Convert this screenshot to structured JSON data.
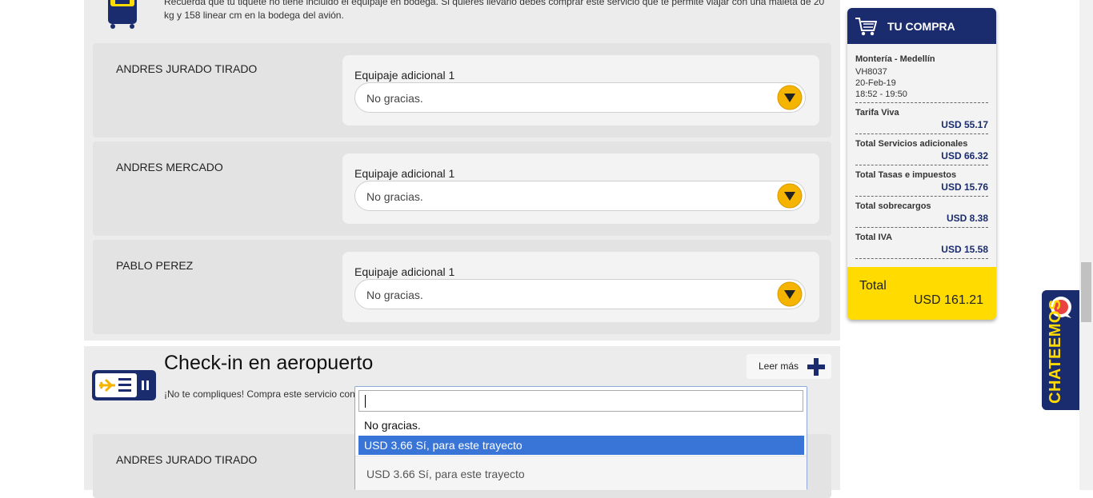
{
  "baggage": {
    "note": "Recuerda que tu tiquete no tiene incluido el equipaje en bodega. Si quieres llevarlo debes comprar este servicio que te permite viajar con una maleta de 20 kg y 158 linear cm en la bodega del avión.",
    "passengers": [
      {
        "name": "ANDRES JURADO TIRADO",
        "label": "Equipaje adicional 1",
        "value": "No gracias."
      },
      {
        "name": "ANDRES MERCADO",
        "label": "Equipaje adicional 1",
        "value": "No gracias."
      },
      {
        "name": "PABLO PEREZ",
        "label": "Equipaje adicional 1",
        "value": "No gracias."
      }
    ]
  },
  "checkin": {
    "title": "Check-in en aeropuerto",
    "description": "¡No te compliques! Compra este servicio con anticipación y haz tu check-in directamente en el aeropuerto, hasta una hora antes de tu vuelo.",
    "more_label": "Leer más",
    "passenger": {
      "name": "ANDRES JURADO TIRADO"
    },
    "dropdown": {
      "search_value": "",
      "options": [
        "No gracias.",
        "USD 3.66 Sí, para este trayecto"
      ],
      "highlighted_index": 1,
      "current_value": "USD 3.66 Sí, para este trayecto"
    }
  },
  "cart": {
    "title": "TU COMPRA",
    "route": "Montería - Medellín",
    "flight": "VH8037",
    "date": "20-Feb-19",
    "time": "18:52 - 19:50",
    "lines": [
      {
        "label": "Tarifa Viva",
        "value": "USD 55.17"
      },
      {
        "label": "Total Servicios adicionales",
        "value": "USD 66.32"
      },
      {
        "label": "Total Tasas e impuestos",
        "value": "USD 15.76"
      },
      {
        "label": "Total sobrecargos",
        "value": "USD 8.38"
      },
      {
        "label": "Total IVA",
        "value": "USD 15.58"
      }
    ],
    "total_label": "Total",
    "total_value": "USD 161.21"
  },
  "chat": {
    "label": "CHATEEMOS"
  },
  "colors": {
    "navy": "#1a2c6d",
    "yellow": "#ffdb00",
    "highlight": "#3875d7"
  }
}
